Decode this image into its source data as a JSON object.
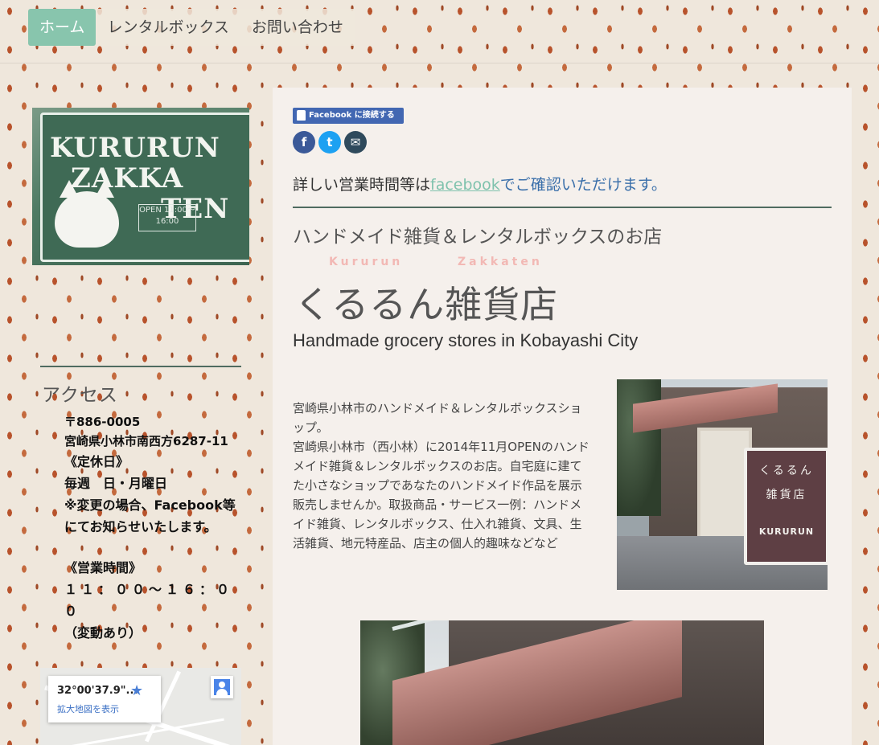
{
  "nav": {
    "items": [
      {
        "label": "ホーム",
        "active": true
      },
      {
        "label": "レンタルボックス",
        "active": false
      },
      {
        "label": "お問い合わせ",
        "active": false
      }
    ]
  },
  "sidebar": {
    "sign": {
      "line1": "KURURUN",
      "line2": "ZAKKA",
      "line3": "TEN",
      "open_text": "OPEN 11:00〜16:00"
    },
    "access_title": "アクセス",
    "postal": "〒886-0005",
    "address": "宮崎県小林市南西方6287-11",
    "closed_heading": "《定休日》",
    "closed_days": "毎週　日・月曜日",
    "closed_note": "※変更の場合、Facebook等にてお知らせいたします。",
    "hours_heading": "《営業時間》",
    "hours": "１１：００〜１６：００",
    "hours_note": "（変動あり）",
    "map": {
      "coord": "32°00'37.9\"...",
      "link": "拡大地図を表示"
    }
  },
  "main": {
    "fb_connect_label": "Facebook に接続する",
    "share": {
      "facebook": "f",
      "twitter": "t",
      "mail": "✉"
    },
    "notice_prefix": "詳しい営業時間等は",
    "notice_link": "facebook",
    "notice_suffix": "でご確認いただけます。",
    "tagline": "ハンドメイド雑貨＆レンタルボックスのお店",
    "romaji_1": "Kururun",
    "romaji_2": "Zakkaten",
    "shop_name": "くるるん雑貨店",
    "subtitle": "Handmade grocery stores in Kobayashi City",
    "description": "宮崎県小林市のハンドメイド＆レンタルボックスショップ。\n宮崎県小林市（西小林）に2014年11月OPENのハンドメイド雑貨＆レンタルボックスのお店。自宅庭に建てた小さなショップであなたのハンドメイド作品を展示販売しませんか。取扱商品・サービス一例：ハンドメイド雑貨、レンタルボックス、仕入れ雑貨、文具、生活雑貨、地元特産品、店主の個人的趣味などなど",
    "photo_sign": {
      "line1": "くるるん",
      "line2": "雑貨店",
      "line3": "KURURUN"
    }
  },
  "colors": {
    "nav_active": "#88c5ad",
    "link": "#7fc2ad",
    "rule": "#4f6b60",
    "facebook": "#4267b2",
    "twitter": "#1da1f2"
  }
}
